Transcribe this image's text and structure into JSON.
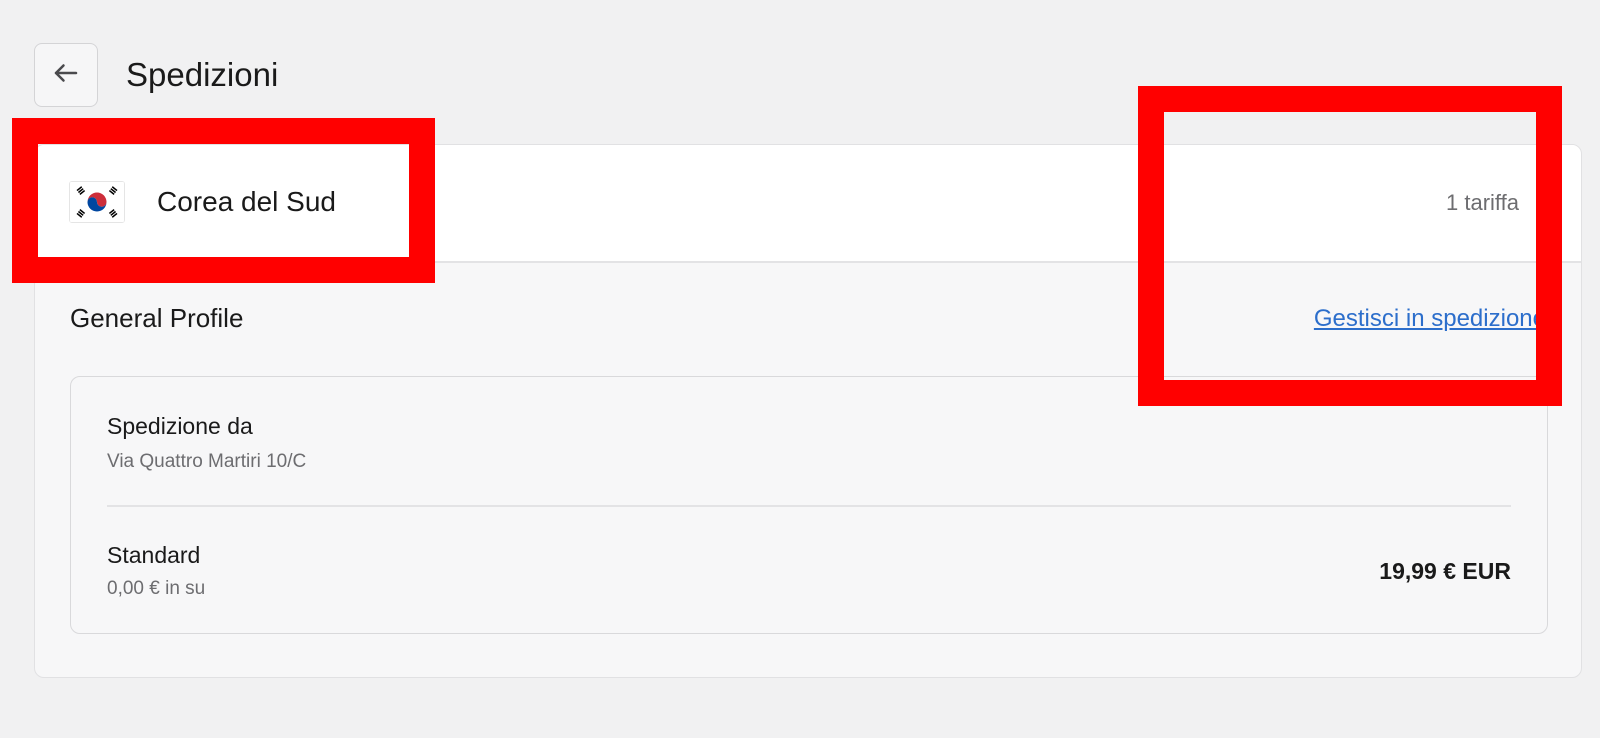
{
  "header": {
    "title": "Spedizioni",
    "back_icon": "arrow-left-icon"
  },
  "zone": {
    "flag_icon": "south-korea-flag-icon",
    "country": "Corea del Sud",
    "rate_count": "1 tariffa"
  },
  "profile": {
    "name": "General Profile",
    "manage_link": "Gestisci in spedizione"
  },
  "origin": {
    "label": "Spedizione da",
    "address": "Via Quattro Martiri 10/C"
  },
  "rate": {
    "name": "Standard",
    "condition": "0,00 € in su",
    "price": "19,99 € EUR"
  },
  "colors": {
    "highlight": "#ff0000",
    "link": "#2c6ecb",
    "background": "#f1f1f2"
  }
}
